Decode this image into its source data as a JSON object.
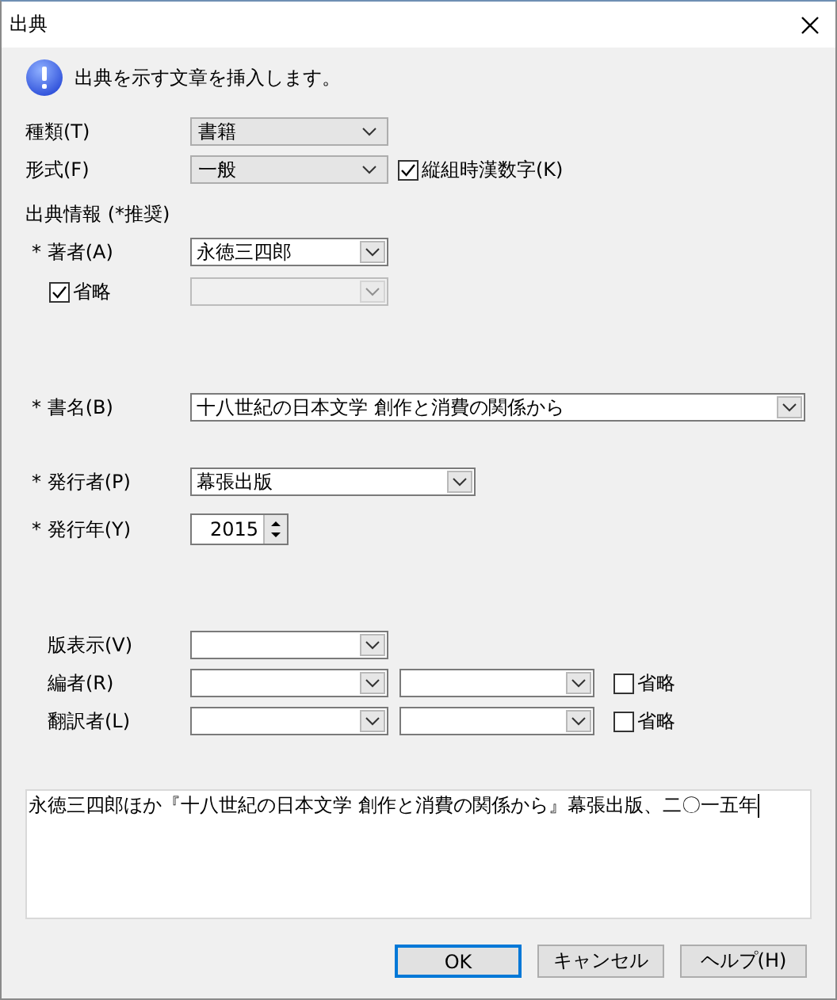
{
  "window": {
    "title": "出典"
  },
  "message": "出典を示す文章を挿入します。",
  "type": {
    "label": "種類(T)",
    "value": "書籍"
  },
  "format": {
    "label": "形式(F)",
    "value": "一般",
    "vertical_kanji": {
      "label": "縦組時漢数字(K)",
      "checked": true
    }
  },
  "section_heading": "出典情報 (*推奨)",
  "author": {
    "label": "* 著者(A)",
    "value": "永徳三四郎",
    "omit": {
      "label": "省略",
      "checked": true
    },
    "omit_field_disabled": true
  },
  "book_title": {
    "label": "* 書名(B)",
    "value": "十八世紀の日本文学 創作と消費の関係から"
  },
  "publisher": {
    "label": "* 発行者(P)",
    "value": "幕張出版"
  },
  "year": {
    "label": "* 発行年(Y)",
    "value": "2015"
  },
  "edition": {
    "label": "版表示(V)"
  },
  "editor": {
    "label": "編者(R)",
    "omit": {
      "label": "省略",
      "checked": false
    }
  },
  "translator": {
    "label": "翻訳者(L)",
    "omit": {
      "label": "省略",
      "checked": false
    }
  },
  "preview": "永徳三四郎ほか『十八世紀の日本文学 創作と消費の関係から』幕張出版、二〇一五年",
  "buttons": [
    {
      "label": "OK",
      "default": true
    },
    {
      "label": "キャンセル",
      "default": false
    },
    {
      "label": "ヘルプ(H)",
      "default": false
    }
  ]
}
